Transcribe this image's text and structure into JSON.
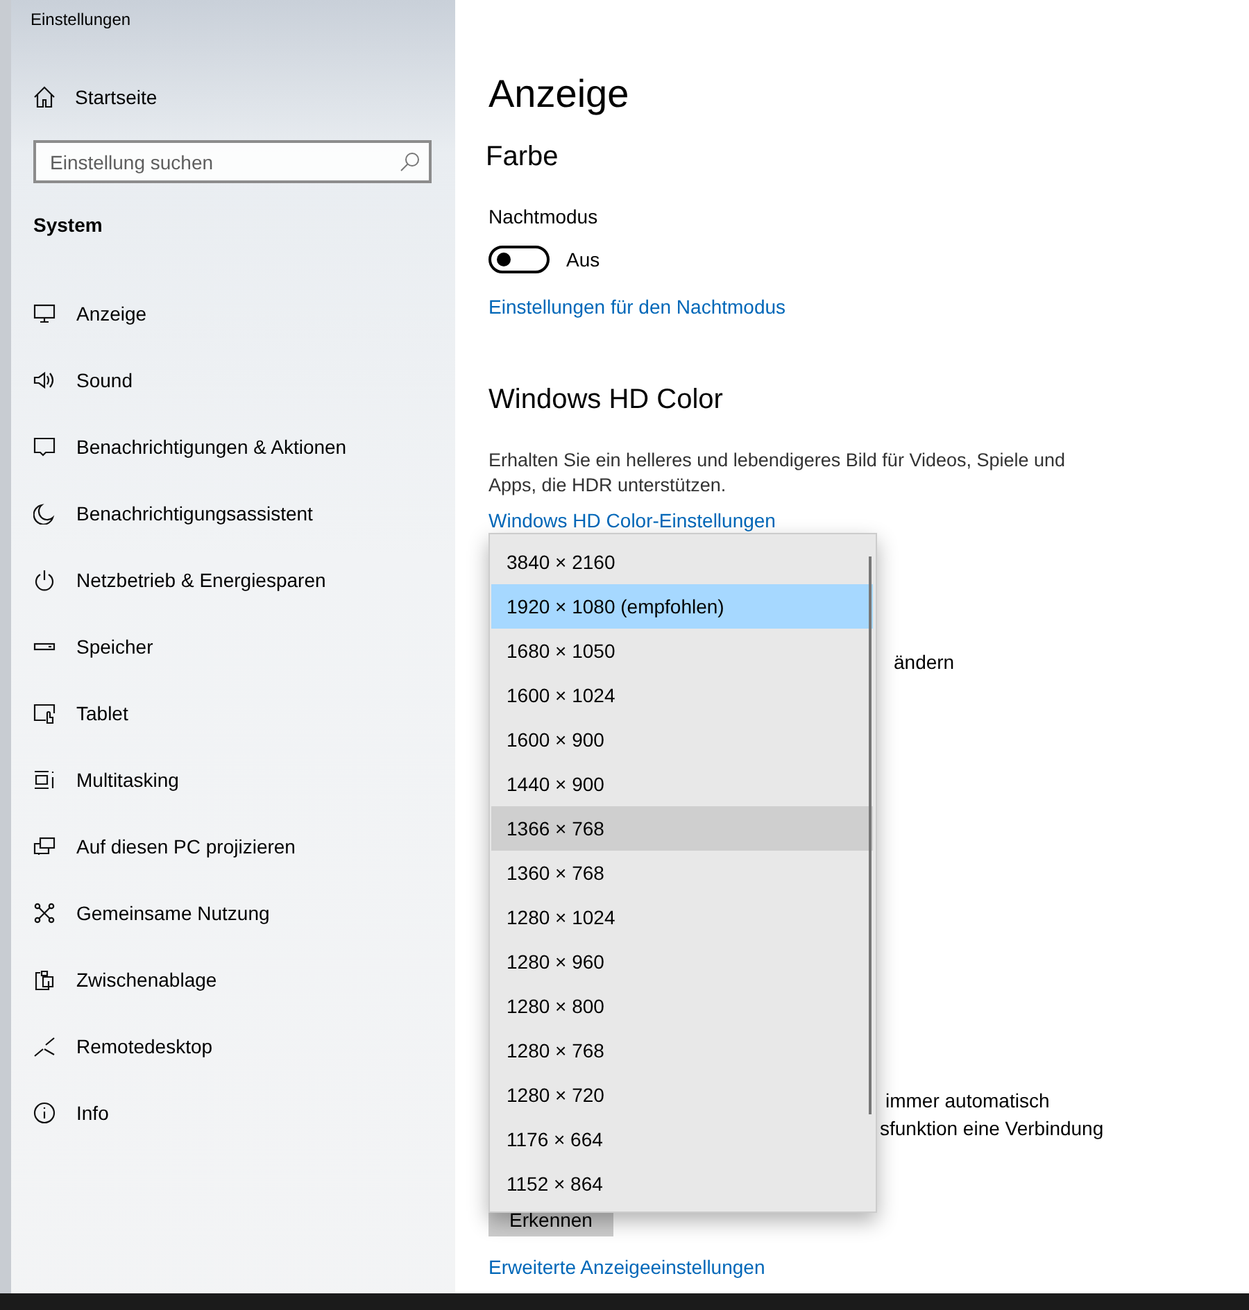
{
  "window": {
    "title": "Einstellungen"
  },
  "sidebar": {
    "home": "Startseite",
    "search": {
      "placeholder": "Einstellung suchen"
    },
    "section": "System",
    "items": [
      {
        "label": "Anzeige"
      },
      {
        "label": "Sound"
      },
      {
        "label": "Benachrichtigungen & Aktionen"
      },
      {
        "label": "Benachrichtigungsassistent"
      },
      {
        "label": "Netzbetrieb & Energiesparen"
      },
      {
        "label": "Speicher"
      },
      {
        "label": "Tablet"
      },
      {
        "label": "Multitasking"
      },
      {
        "label": "Auf diesen PC projizieren"
      },
      {
        "label": "Gemeinsame Nutzung"
      },
      {
        "label": "Zwischenablage"
      },
      {
        "label": "Remotedesktop"
      },
      {
        "label": "Info"
      }
    ]
  },
  "main": {
    "title": "Anzeige",
    "color_heading": "Farbe",
    "night_mode": {
      "label": "Nachtmodus",
      "on": false,
      "state": "Aus"
    },
    "night_link": "Einstellungen für den Nachtmodus",
    "hdr_heading": "Windows HD Color",
    "hdr_text": "Erhalten Sie ein helleres und lebendigeres Bild für Videos, Spiele und Apps, die HDR unterstützen.",
    "hdr_link": "Windows HD Color-Einstellungen",
    "partial_text_1": "ändern",
    "partial_text_2": "immer automatisch",
    "partial_text_3": "sfunktion eine Verbindung",
    "detect_button": "Erkennen",
    "advanced_link": "Erweiterte Anzeigeeinstellungen"
  },
  "resolution_dropdown": {
    "items": [
      {
        "label": "3840 × 2160",
        "selected": false,
        "hovered": false
      },
      {
        "label": "1920 × 1080 (empfohlen)",
        "selected": true,
        "hovered": false
      },
      {
        "label": "1680 × 1050",
        "selected": false,
        "hovered": false
      },
      {
        "label": "1600 × 1024",
        "selected": false,
        "hovered": false
      },
      {
        "label": "1600 × 900",
        "selected": false,
        "hovered": false
      },
      {
        "label": "1440 × 900",
        "selected": false,
        "hovered": false
      },
      {
        "label": "1366 × 768",
        "selected": false,
        "hovered": true
      },
      {
        "label": "1360 × 768",
        "selected": false,
        "hovered": false
      },
      {
        "label": "1280 × 1024",
        "selected": false,
        "hovered": false
      },
      {
        "label": "1280 × 960",
        "selected": false,
        "hovered": false
      },
      {
        "label": "1280 × 800",
        "selected": false,
        "hovered": false
      },
      {
        "label": "1280 × 768",
        "selected": false,
        "hovered": false
      },
      {
        "label": "1280 × 720",
        "selected": false,
        "hovered": false
      },
      {
        "label": "1176 × 664",
        "selected": false,
        "hovered": false
      },
      {
        "label": "1152 × 864",
        "selected": false,
        "hovered": false
      }
    ]
  }
}
